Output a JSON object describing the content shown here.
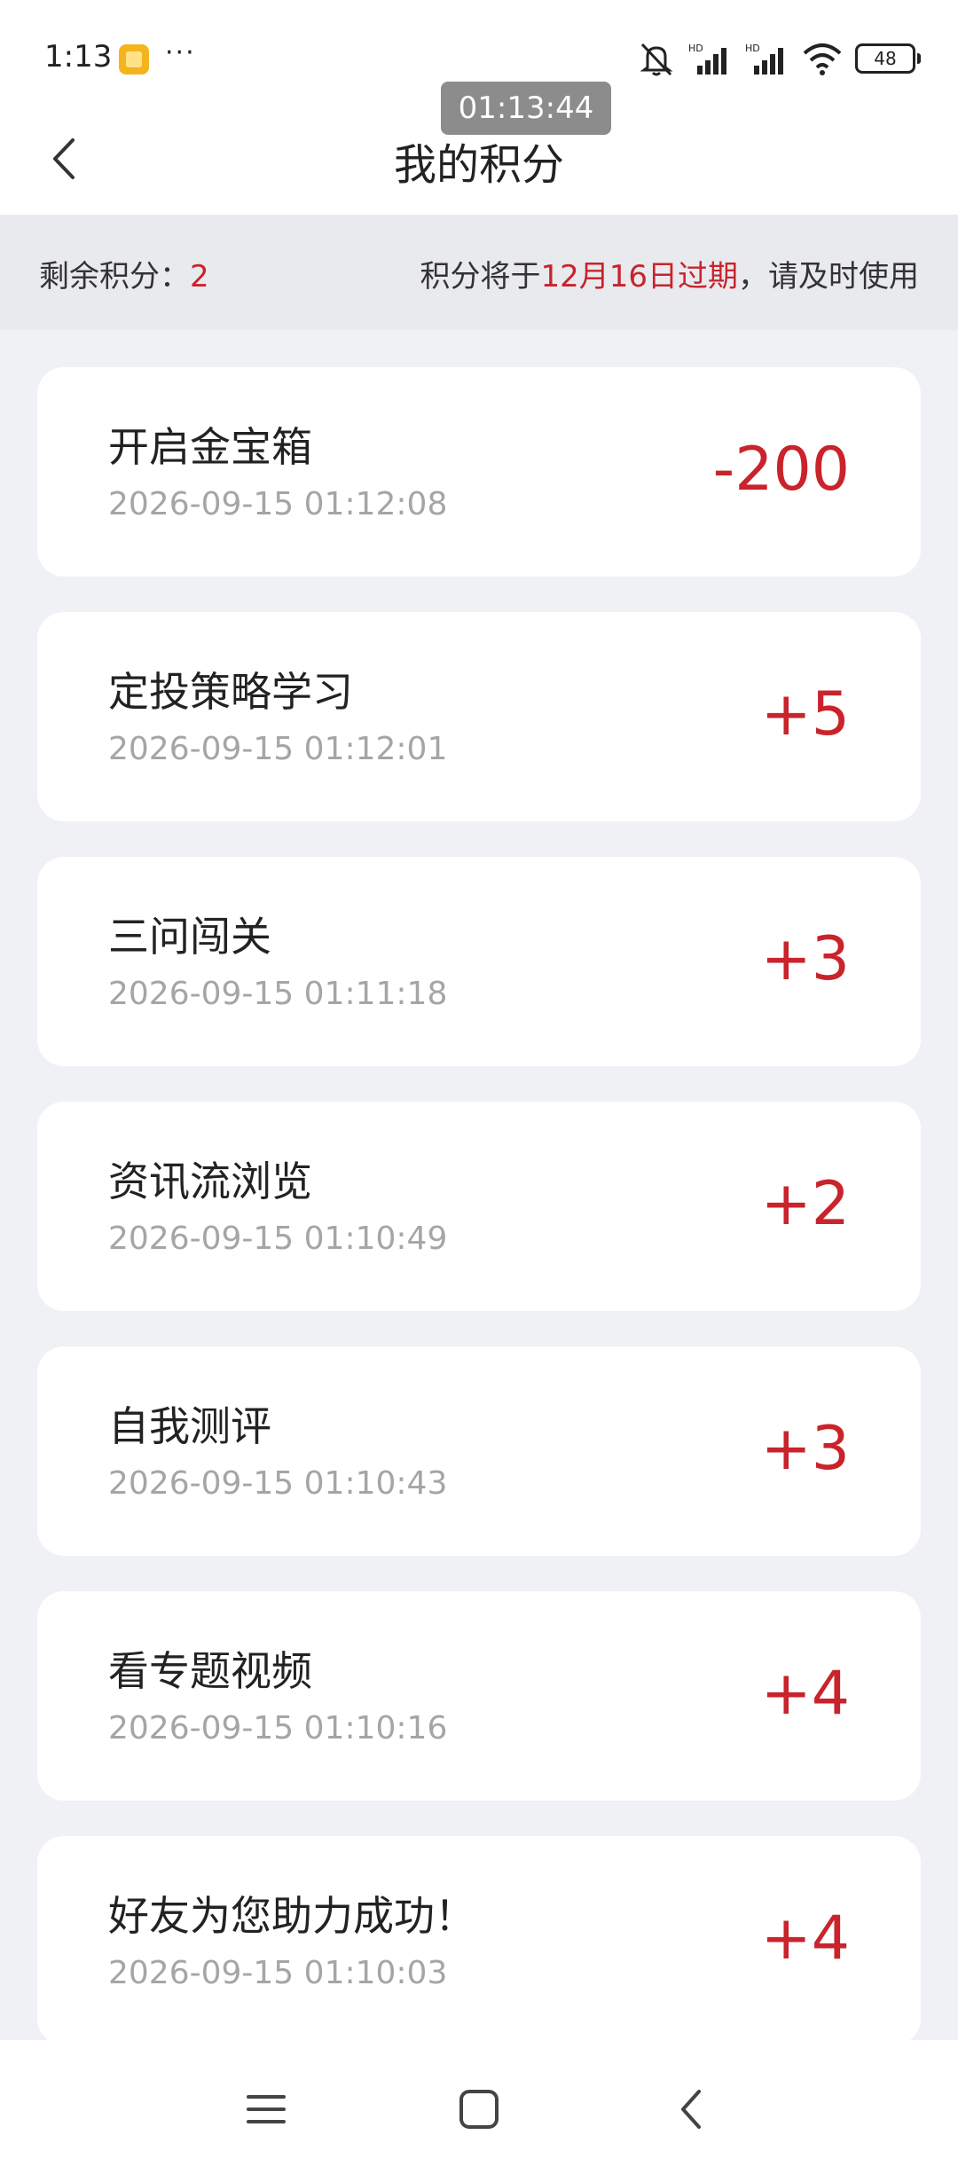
{
  "status_bar": {
    "time": "1:13",
    "more": "···",
    "battery": "48",
    "icons": [
      "app-notification-icon",
      "mute-icon",
      "signal-hd-icon",
      "signal-hd-icon",
      "wifi-icon",
      "battery-icon"
    ]
  },
  "recorder": {
    "time": "01:13:44"
  },
  "header": {
    "title": "我的积分",
    "back_icon": "chevron-left-icon"
  },
  "summary": {
    "remaining_label": "剩余积分：",
    "remaining_value": "2",
    "expire_prefix": "积分将于",
    "expire_date": "12月16日过期",
    "expire_suffix": "，请及时使用"
  },
  "records": [
    {
      "title": "开启金宝箱",
      "time": "2026-09-15 01:12:08",
      "points": "-200"
    },
    {
      "title": "定投策略学习",
      "time": "2026-09-15 01:12:01",
      "points": "+5"
    },
    {
      "title": "三问闯关",
      "time": "2026-09-15 01:11:18",
      "points": "+3"
    },
    {
      "title": "资讯流浏览",
      "time": "2026-09-15 01:10:49",
      "points": "+2"
    },
    {
      "title": "自我测评",
      "time": "2026-09-15 01:10:43",
      "points": "+3"
    },
    {
      "title": "看专题视频",
      "time": "2026-09-15 01:10:16",
      "points": "+4"
    },
    {
      "title": "好友为您助力成功！",
      "time": "2026-09-15 01:10:03",
      "points": "+4"
    }
  ],
  "colors": {
    "accent": "#c9232b",
    "background": "#f0f1f5",
    "card": "#ffffff"
  },
  "bottom_nav": {
    "icons": [
      "menu-icon",
      "home-icon",
      "back-icon"
    ]
  }
}
